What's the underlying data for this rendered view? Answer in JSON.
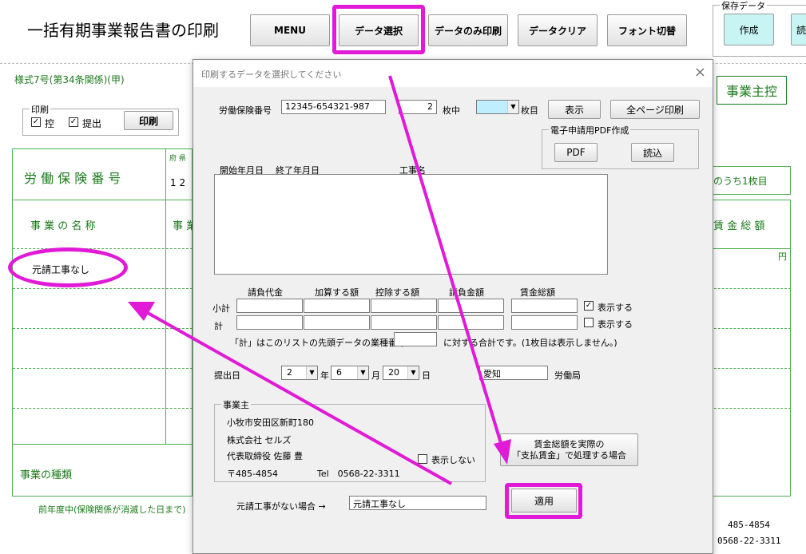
{
  "app": {
    "title": "一括有期事業報告書の印刷",
    "toolbar": {
      "menu": "MENU",
      "data_select": "データ選択",
      "data_only_print": "データのみ印刷",
      "data_clear": "データクリア",
      "font_switch": "フォント切替"
    },
    "save_data": {
      "label": "保存データ",
      "create": "作成",
      "read_partial": "読"
    },
    "form_label": "様式7号(第34条関係)(甲)",
    "business_owner_copy": "事業主控",
    "print_group": {
      "title": "印刷",
      "ctrl_label": "控",
      "submit_label": "提出",
      "print_button": "印刷",
      "ctrl_checked": true,
      "submit_checked": true
    },
    "form": {
      "labor_ins_no_label": "労 働 保 険 番 号",
      "pref_header": "府 県",
      "pref_digits": "1 2",
      "page_of": "のうち1枚目",
      "business_name_label": "事 業 の 名 称",
      "business_name_partial": "事 業",
      "wage_total_label": "賃 金 総 額",
      "yen": "円",
      "first_row_text": "元請工事なし",
      "business_type_label": "事業の種類",
      "prev_year_note": "前年度中(保険関係が消滅した日まで)",
      "zip_right": "485-4854",
      "tel_right": "0568-22-3311"
    }
  },
  "dialog": {
    "title": "印刷するデータを選択してください",
    "labor_ins_no_label": "労働保険番号",
    "labor_ins_no_value": "12345-654321-987",
    "page_count": "2",
    "page_count_suffix": "枚中",
    "page_select_value": "",
    "page_select_suffix": "枚目",
    "show_button": "表示",
    "all_pages_print_button": "全ページ印刷",
    "pdf_group": {
      "title": "電子申請用PDF作成",
      "pdf_button": "PDF",
      "read_button": "読込"
    },
    "list_headers": {
      "start": "開始年月日",
      "end": "終了年月日",
      "work_name": "工事名"
    },
    "amount_headers": [
      "請負代金",
      "加算する額",
      "控除する額",
      "請負金額",
      "賃金総額"
    ],
    "row_subtotal": "小計",
    "row_total": "計",
    "show_subtotal_label": "表示する",
    "show_subtotal_checked": true,
    "show_total_label": "表示する",
    "show_total_checked": false,
    "note_prefix": "「計」はこのリストの先頭データの業種番号",
    "note_suffix": "に対する合計です。(1枚目は表示しません。)",
    "submit_date_label": "提出日",
    "date_month": "2",
    "date_month_suffix": "年",
    "date_day_month": "6",
    "date_day_month_suffix": "月",
    "date_day": "20",
    "date_day_suffix": "日",
    "bureau_value": "愛知",
    "bureau_suffix": "労働局",
    "employer_group": {
      "title": "事業主",
      "address": "小牧市安田区新町180",
      "company": "株式会社 セルズ",
      "representative": "代表取締役 佐藤 豊",
      "zip": "〒485-4854",
      "tel": "Tel　0568-22-3311",
      "hide_label": "表示しない",
      "hide_checked": false
    },
    "wage_button_line1": "賃金総額を実際の",
    "wage_button_line2": "「支払賃金」で処理する場合",
    "no_main_contract_label": "元請工事がない場合 →",
    "no_main_contract_value": "元請工事なし",
    "apply_button": "適用"
  },
  "colors": {
    "highlight": "#e01ad6",
    "form_green": "#1a7a1a",
    "page_select_bg": "#bfefff",
    "save_create_bg": "#c8f4f4"
  }
}
